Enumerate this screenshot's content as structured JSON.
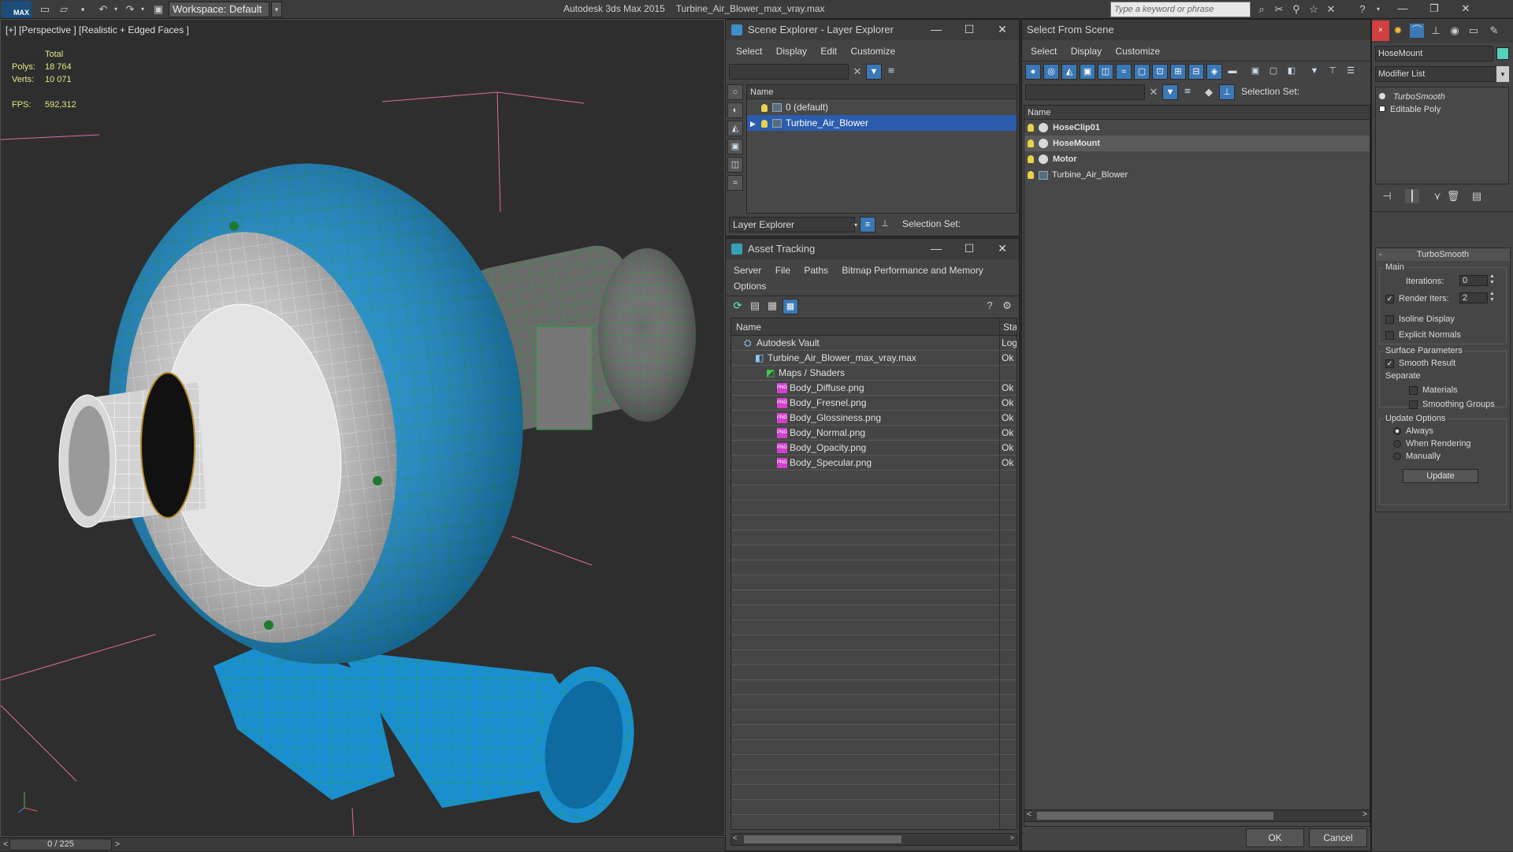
{
  "app": {
    "title_app": "Autodesk 3ds Max  2015",
    "title_file": "Turbine_Air_Blower_max_vray.max",
    "logo": "MAX",
    "workspace": "Workspace: Default",
    "search_placeholder": "Type a keyword or phrase"
  },
  "viewport": {
    "label": "[+] [Perspective ] [Realistic + Edged Faces ]",
    "stats_header": "Total",
    "polys_label": "Polys:",
    "polys_value": "18 764",
    "verts_label": "Verts:",
    "verts_value": "10 071",
    "fps_label": "FPS:",
    "fps_value": "592,312",
    "time": "0 / 225",
    "colors": {
      "body": "#1a8fd0",
      "mesh": "#1f9a3a",
      "face": "#cfcfcf"
    }
  },
  "scene_explorer": {
    "title": "Scene Explorer - Layer Explorer",
    "menus": [
      "Select",
      "Display",
      "Edit",
      "Customize"
    ],
    "column": "Name",
    "layers": [
      {
        "label": "0 (default)",
        "selected": false
      },
      {
        "label": "Turbine_Air_Blower",
        "selected": true
      }
    ],
    "footer_dropdown": "Layer Explorer",
    "selection_set": "Selection Set:"
  },
  "asset_tracking": {
    "title": "Asset Tracking",
    "menus": [
      "Server",
      "File",
      "Paths",
      "Bitmap Performance and Memory"
    ],
    "menus_row2": [
      "Options"
    ],
    "col_name": "Name",
    "col_status": "Statu",
    "rows": [
      {
        "name": "Autodesk Vault",
        "status": "Logg",
        "indent": 1,
        "icon": "vault-icon"
      },
      {
        "name": "Turbine_Air_Blower_max_vray.max",
        "status": "Ok",
        "indent": 2,
        "icon": "max-file-icon"
      },
      {
        "name": "Maps / Shaders",
        "status": "",
        "indent": 3,
        "icon": "maps-icon"
      },
      {
        "name": "Body_Diffuse.png",
        "status": "Ok",
        "indent": 4,
        "icon": "png-icon"
      },
      {
        "name": "Body_Fresnel.png",
        "status": "Ok",
        "indent": 4,
        "icon": "png-icon"
      },
      {
        "name": "Body_Glossiness.png",
        "status": "Ok",
        "indent": 4,
        "icon": "png-icon"
      },
      {
        "name": "Body_Normal.png",
        "status": "Ok",
        "indent": 4,
        "icon": "png-icon"
      },
      {
        "name": "Body_Opacity.png",
        "status": "Ok",
        "indent": 4,
        "icon": "png-icon"
      },
      {
        "name": "Body_Specular.png",
        "status": "Ok",
        "indent": 4,
        "icon": "png-icon"
      }
    ],
    "png_badge": "PNG"
  },
  "select_from_scene": {
    "title": "Select From Scene",
    "menus": [
      "Select",
      "Display",
      "Customize"
    ],
    "selection_set": "Selection Set:",
    "column": "Name",
    "objects": [
      {
        "label": "HoseClip01",
        "bold": true,
        "highlight": false
      },
      {
        "label": "HoseMount",
        "bold": true,
        "highlight": true
      },
      {
        "label": "Motor",
        "bold": true,
        "highlight": false
      },
      {
        "label": "Turbine_Air_Blower",
        "bold": false,
        "highlight": false
      }
    ],
    "ok": "OK",
    "cancel": "Cancel"
  },
  "command_panel": {
    "object_name": "HoseMount",
    "modifier_list": "Modifier List",
    "stack": [
      "TurboSmooth",
      "Editable Poly"
    ],
    "rollout_title": "TurboSmooth",
    "main_label": "Main",
    "iterations_label": "Iterations:",
    "iterations_value": "0",
    "render_iters_label": "Render Iters:",
    "render_iters_value": "2",
    "render_iters_checked": true,
    "isoline": "Isoline Display",
    "explicit_normals": "Explicit Normals",
    "surface_params": "Surface Parameters",
    "smooth_result": "Smooth Result",
    "separate": "Separate",
    "materials": "Materials",
    "smoothing_groups": "Smoothing Groups",
    "update_options": "Update Options",
    "always": "Always",
    "when_rendering": "When Rendering",
    "manually": "Manually",
    "update_button": "Update"
  }
}
